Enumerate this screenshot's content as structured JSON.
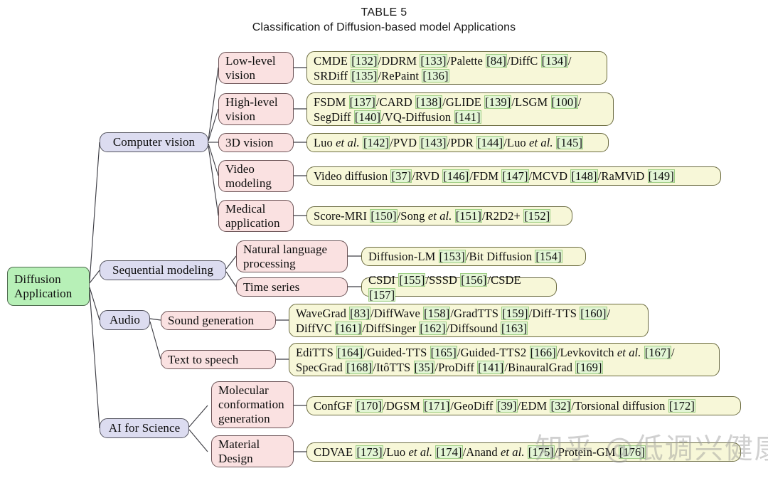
{
  "title": {
    "line1": "TABLE 5",
    "line2": "Classification of Diffusion-based model Applications"
  },
  "colors": {
    "root_fill": "#b7f0b7",
    "category_fill": "#dcdcf0",
    "subcategory_fill": "#fae1e1",
    "leaf_fill": "#f7f7d8",
    "citation_highlight": "#e2f5d5",
    "border": "#4a4a52"
  },
  "root": {
    "label": "Diffusion\nApplication"
  },
  "categories": [
    {
      "id": "computer-vision",
      "label": "Computer vision"
    },
    {
      "id": "sequential-modeling",
      "label": "Sequential modeling"
    },
    {
      "id": "audio",
      "label": "Audio"
    },
    {
      "id": "ai-for-science",
      "label": "AI for Science"
    }
  ],
  "subcategories": [
    {
      "id": "low-level-vision",
      "label": "Low-level\nvision"
    },
    {
      "id": "high-level-vision",
      "label": "High-level\nvision"
    },
    {
      "id": "3d-vision",
      "label": "3D vision"
    },
    {
      "id": "video-modeling",
      "label": "Video\nmodeling"
    },
    {
      "id": "medical-application",
      "label": "Medical\napplication"
    },
    {
      "id": "natural-language-processing",
      "label": "Natural language\nprocessing"
    },
    {
      "id": "time-series",
      "label": "Time series"
    },
    {
      "id": "sound-generation",
      "label": "Sound generation"
    },
    {
      "id": "text-to-speech",
      "label": "Text to speech"
    },
    {
      "id": "molecular-conformation-generation",
      "label": "Molecular\nconformation\ngeneration"
    },
    {
      "id": "material-design",
      "label": "Material\nDesign"
    }
  ],
  "leaves": [
    {
      "id": "leaf-low-level-vision",
      "text": "CMDE [132]/DDRM [133]/Palette [84]/DiffC [134]/ SRDiff [135]/RePaint [136]",
      "items": [
        {
          "name": "CMDE",
          "ref": "[132]"
        },
        {
          "name": "DDRM",
          "ref": "[133]"
        },
        {
          "name": "Palette",
          "ref": "[84]"
        },
        {
          "name": "DiffC",
          "ref": "[134]"
        },
        {
          "name": "SRDiff",
          "ref": "[135]"
        },
        {
          "name": "RePaint",
          "ref": "[136]"
        }
      ]
    },
    {
      "id": "leaf-high-level-vision",
      "text": "FSDM [137]/CARD [138]/GLIDE [139]/LSGM [100]/ SegDiff [140]/VQ-Diffusion [141]",
      "items": [
        {
          "name": "FSDM",
          "ref": "[137]"
        },
        {
          "name": "CARD",
          "ref": "[138]"
        },
        {
          "name": "GLIDE",
          "ref": "[139]"
        },
        {
          "name": "LSGM",
          "ref": "[100]"
        },
        {
          "name": "SegDiff",
          "ref": "[140]"
        },
        {
          "name": "VQ-Diffusion",
          "ref": "[141]"
        }
      ]
    },
    {
      "id": "leaf-3d-vision",
      "text": "Luo et al. [142]/PVD [143]/PDR [144]/Luo et al. [145]",
      "items": [
        {
          "name": "Luo et al.",
          "ref": "[142]"
        },
        {
          "name": "PVD",
          "ref": "[143]"
        },
        {
          "name": "PDR",
          "ref": "[144]"
        },
        {
          "name": "Luo et al.",
          "ref": "[145]"
        }
      ]
    },
    {
      "id": "leaf-video-modeling",
      "text": "Video diffusion [37]/RVD [146]/FDM [147]/MCVD [148]/RaMViD [149]",
      "items": [
        {
          "name": "Video diffusion",
          "ref": "[37]"
        },
        {
          "name": "RVD",
          "ref": "[146]"
        },
        {
          "name": "FDM",
          "ref": "[147]"
        },
        {
          "name": "MCVD",
          "ref": "[148]"
        },
        {
          "name": "RaMViD",
          "ref": "[149]"
        }
      ]
    },
    {
      "id": "leaf-medical-application",
      "text": "Score-MRI [150]/Song et al. [151]/R2D2+ [152]",
      "items": [
        {
          "name": "Score-MRI",
          "ref": "[150]"
        },
        {
          "name": "Song et al.",
          "ref": "[151]"
        },
        {
          "name": "R2D2+",
          "ref": "[152]"
        }
      ]
    },
    {
      "id": "leaf-natural-language-processing",
      "text": "Diffusion-LM [153]/Bit Diffusion [154]",
      "items": [
        {
          "name": "Diffusion-LM",
          "ref": "[153]"
        },
        {
          "name": "Bit Diffusion",
          "ref": "[154]"
        }
      ]
    },
    {
      "id": "leaf-time-series",
      "text": "CSDI [155]/SSSD [156]/CSDE [157]",
      "items": [
        {
          "name": "CSDI",
          "ref": "[155]"
        },
        {
          "name": "SSSD",
          "ref": "[156]"
        },
        {
          "name": "CSDE",
          "ref": "[157]"
        }
      ]
    },
    {
      "id": "leaf-sound-generation",
      "text": "WaveGrad [83]/DiffWave [158]/GradTTS [159]/Diff-TTS [160]/ DiffVC [161]/DiffSinger [162]/Diffsound [163]",
      "items": [
        {
          "name": "WaveGrad",
          "ref": "[83]"
        },
        {
          "name": "DiffWave",
          "ref": "[158]"
        },
        {
          "name": "GradTTS",
          "ref": "[159]"
        },
        {
          "name": "Diff-TTS",
          "ref": "[160]"
        },
        {
          "name": "DiffVC",
          "ref": "[161]"
        },
        {
          "name": "DiffSinger",
          "ref": "[162]"
        },
        {
          "name": "Diffsound",
          "ref": "[163]"
        }
      ]
    },
    {
      "id": "leaf-text-to-speech",
      "text": "EdiTTS [164]/Guided-TTS [165]/Guided-TTS2 [166]/Levkovitch et al. [167]/ SpecGrad [168]/ItôTTS [35]/ProDiff [141]/BinauralGrad [169]",
      "items": [
        {
          "name": "EdiTTS",
          "ref": "[164]"
        },
        {
          "name": "Guided-TTS",
          "ref": "[165]"
        },
        {
          "name": "Guided-TTS2",
          "ref": "[166]"
        },
        {
          "name": "Levkovitch et al.",
          "ref": "[167]"
        },
        {
          "name": "SpecGrad",
          "ref": "[168]"
        },
        {
          "name": "ItôTTS",
          "ref": "[35]"
        },
        {
          "name": "ProDiff",
          "ref": "[141]"
        },
        {
          "name": "BinauralGrad",
          "ref": "[169]"
        }
      ]
    },
    {
      "id": "leaf-molecular-conformation-generation",
      "text": "ConfGF [170]/DGSM [171]/GeoDiff [39]/EDM [32]/Torsional diffusion [172]",
      "items": [
        {
          "name": "ConfGF",
          "ref": "[170]"
        },
        {
          "name": "DGSM",
          "ref": "[171]"
        },
        {
          "name": "GeoDiff",
          "ref": "[39]"
        },
        {
          "name": "EDM",
          "ref": "[32]"
        },
        {
          "name": "Torsional diffusion",
          "ref": "[172]"
        }
      ]
    },
    {
      "id": "leaf-material-design",
      "text": "CDVAE [173]/Luo et al. [174]/Anand et al. [175]/Protein-GM [176]",
      "items": [
        {
          "name": "CDVAE",
          "ref": "[173]"
        },
        {
          "name": "Luo et al.",
          "ref": "[174]"
        },
        {
          "name": "Anand et al.",
          "ref": "[175]"
        },
        {
          "name": "Protein-GM",
          "ref": "[176]"
        }
      ]
    }
  ],
  "watermark": {
    "text": "知乎 @低调兴健康"
  }
}
